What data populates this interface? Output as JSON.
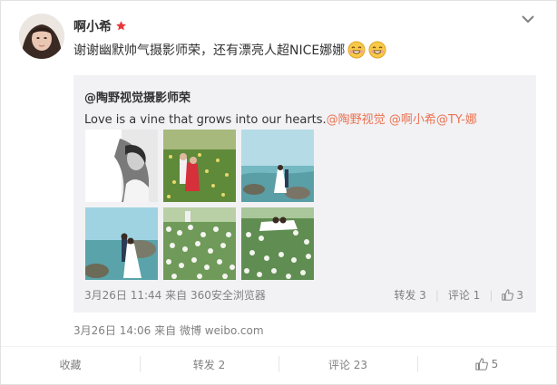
{
  "post": {
    "author": "啊小希",
    "text": "谢谢幽默帅气摄影师荣，还有漂亮人超NICE娜娜",
    "time": "3月26日 14:06",
    "via_prefix": "来自",
    "via_source": "微博 weibo.com",
    "emoji_count": 2
  },
  "repost": {
    "author": "@陶野视觉摄影师荣",
    "text": "Love is a vine that grows into our hearts.",
    "mentions": [
      "@陶野视觉",
      "@啊小希",
      "@TY-娜"
    ],
    "time": "3月26日 11:44",
    "via_prefix": "来自",
    "via_source": "360安全浏览器",
    "forward_label": "转发 3",
    "comment_label": "评论 1",
    "like_count": "3"
  },
  "actions": {
    "collect": "收藏",
    "forward": "转发 2",
    "comment": "评论 23",
    "like": "5"
  },
  "icons": {
    "verified": "red-star-icon",
    "menu": "chevron-down-icon",
    "like": "thumbs-up-icon",
    "emoji": "grin-emoji-icon"
  },
  "colors": {
    "link": "#eb7350",
    "name": "#333333",
    "meta": "#808080",
    "repost_bg": "#f2f2f5",
    "verified": "#e4393c"
  }
}
